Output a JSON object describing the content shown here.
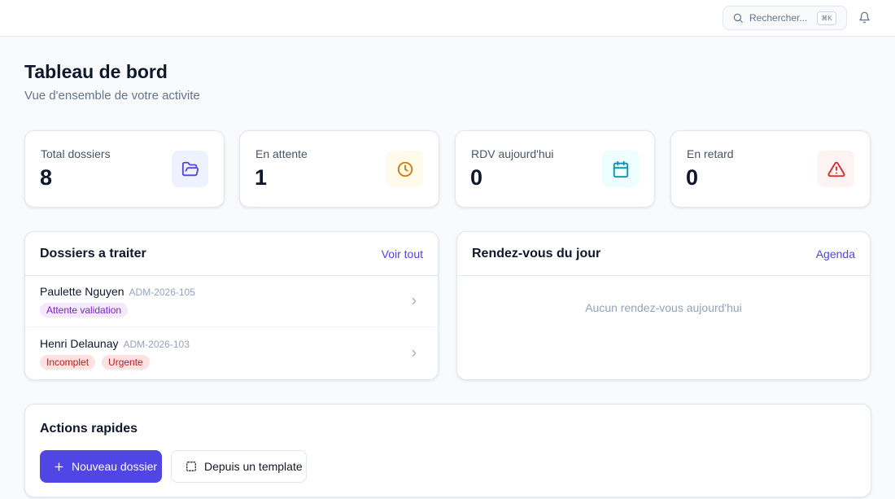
{
  "header": {
    "search": {
      "placeholder": "Rechercher...",
      "shortcut": "⌘K",
      "icon": "search-icon"
    },
    "notifications_icon": "bell-icon"
  },
  "page": {
    "title": "Tableau de bord",
    "subtitle": "Vue d'ensemble de votre activite"
  },
  "stats": [
    {
      "label": "Total dossiers",
      "value": "8",
      "icon": "folder-open-icon",
      "color": "#4f46e5",
      "bg": "#eef2ff"
    },
    {
      "label": "En attente",
      "value": "1",
      "icon": "clock-icon",
      "color": "#d97706",
      "bg": "#fffbeb"
    },
    {
      "label": "RDV aujourd'hui",
      "value": "0",
      "icon": "calendar-icon",
      "color": "#0891b2",
      "bg": "#ecfeff"
    },
    {
      "label": "En retard",
      "value": "0",
      "icon": "alert-triangle-icon",
      "color": "#dc2626",
      "bg": "#fef2f2"
    }
  ],
  "dossiers": {
    "title": "Dossiers a traiter",
    "link": "Voir tout",
    "items": [
      {
        "name": "Paulette Nguyen",
        "ref": "ADM-2026-105",
        "badges": [
          {
            "label": "Attente validation",
            "color": "#7e22ce",
            "bg": "#f3e8ff"
          }
        ]
      },
      {
        "name": "Henri Delaunay",
        "ref": "ADM-2026-103",
        "badges": [
          {
            "label": "Incomplet",
            "color": "#b91c1c",
            "bg": "#fee2e2"
          },
          {
            "label": "Urgente",
            "color": "#b91c1c",
            "bg": "#fee2e2"
          }
        ]
      }
    ]
  },
  "rdv": {
    "title": "Rendez-vous du jour",
    "link": "Agenda",
    "empty": "Aucun rendez-vous aujourd'hui"
  },
  "actions": {
    "title": "Actions rapides",
    "primary": {
      "label": "Nouveau dossier",
      "icon": "plus-icon"
    },
    "secondary": {
      "label": "Depuis un template",
      "icon": "template-icon"
    }
  },
  "colors": {
    "accent": "#4f46e5",
    "text": "#0f172a",
    "muted": "#64748b",
    "border": "#e2e8f0",
    "page_bg": "#f8fafc"
  }
}
